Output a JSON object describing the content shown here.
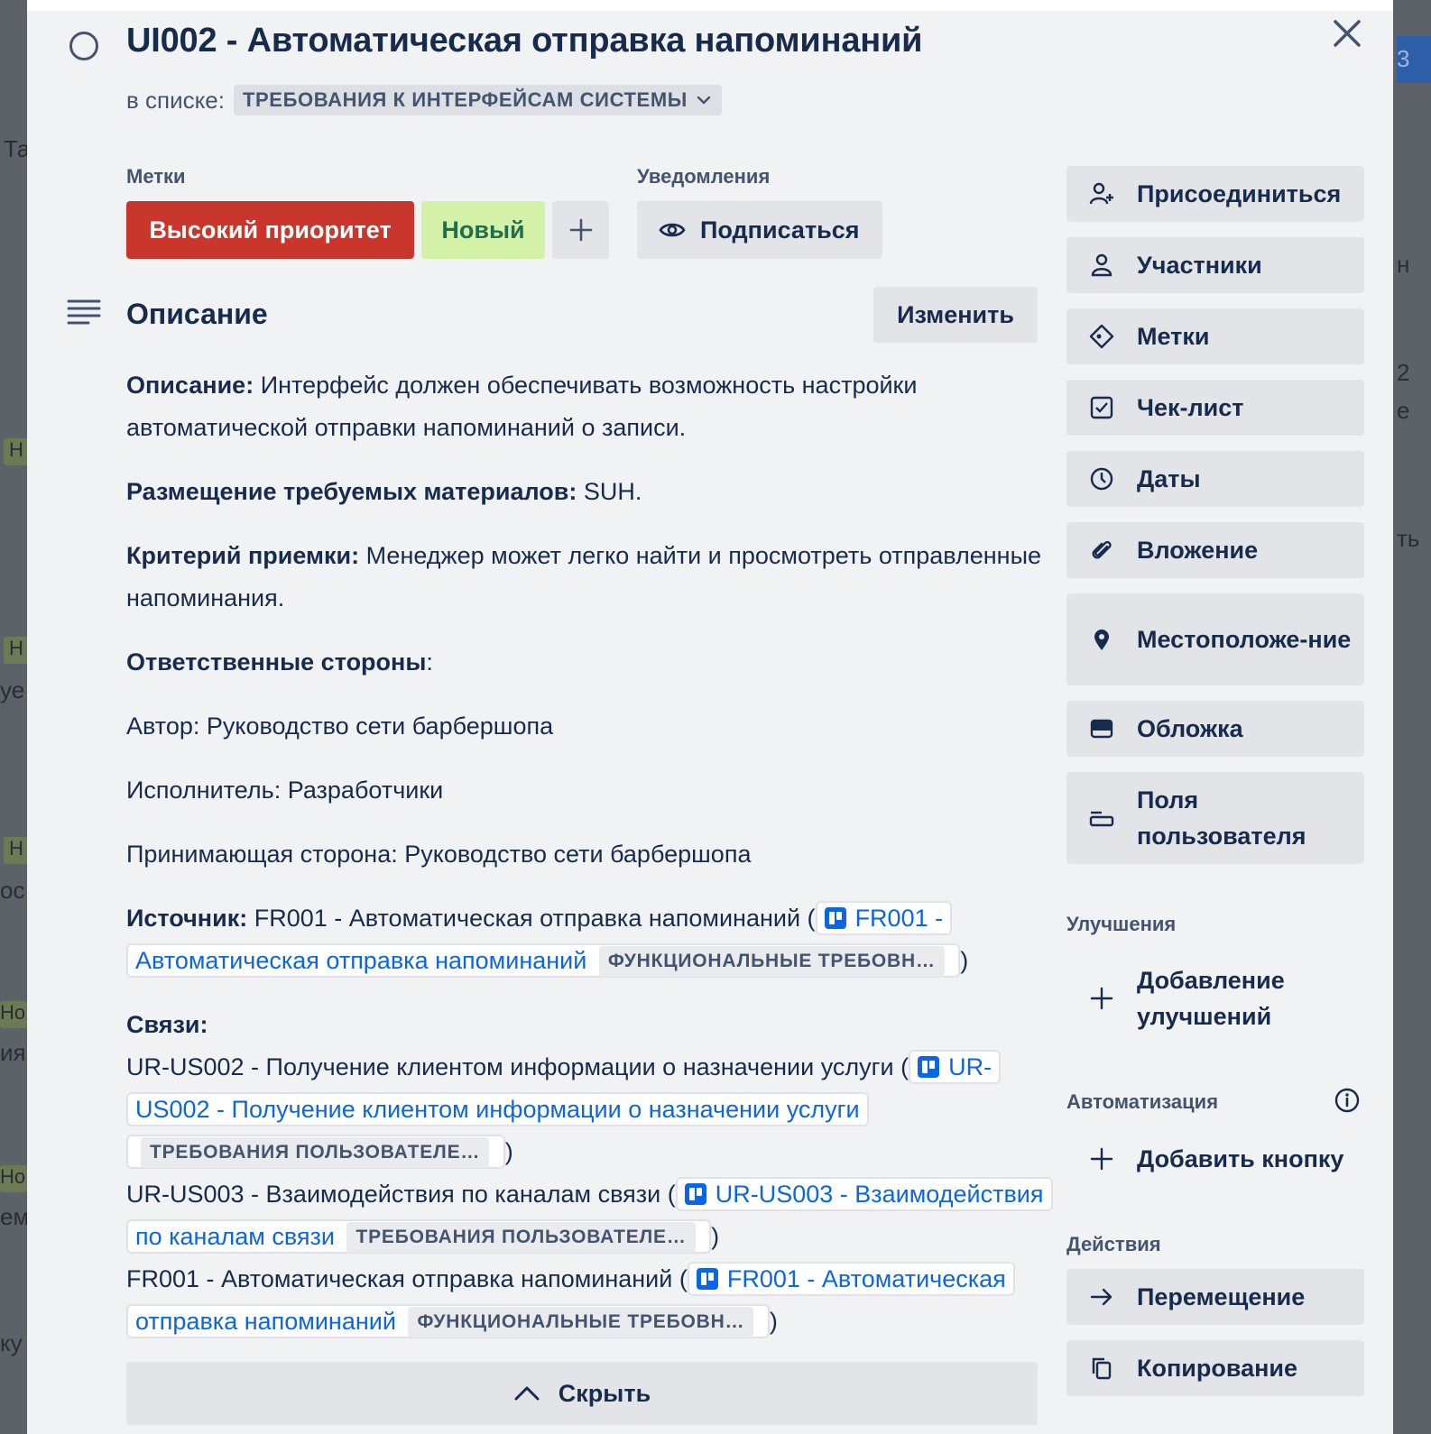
{
  "background": {
    "left_fragments": [
      "Та",
      "Н",
      "Н",
      "уе",
      "Н",
      "ос",
      "Но",
      "ия",
      "Но",
      "ем",
      "ку"
    ],
    "right_fragments": [
      "3",
      "н",
      "2",
      "е",
      "ть"
    ]
  },
  "card": {
    "title": "UI002 - Автоматическая отправка напоминаний",
    "in_list_label": "в списке:",
    "list_name": "ТРЕБОВАНИЯ К ИНТЕРФЕЙСАМ СИСТЕМЫ"
  },
  "labels": {
    "heading": "Метки",
    "items": [
      {
        "text": "Высокий приоритет",
        "color": "#c9372c"
      },
      {
        "text": "Новый",
        "color": "#d3f1a7"
      }
    ]
  },
  "notifications": {
    "heading": "Уведомления",
    "watch_label": "Подписаться"
  },
  "description": {
    "heading": "Описание",
    "edit_label": "Изменить",
    "p1_bold": "Описание:",
    "p1_text": " Интерфейс должен обеспечивать возможность настройки автоматической отправки напоминаний о записи.",
    "p2_bold": "Размещение требуемых материалов:",
    "p2_text": " SUH.",
    "p3_bold": "Критерий приемки:",
    "p3_text": " Менеджер может легко найти и просмотреть отправленные напоминания.",
    "p4_bold": "Ответственные стороны",
    "p4_text": ":",
    "author": "Автор: Руководство сети барбершопа",
    "executor": "Исполнитель: Разработчики",
    "acceptor": "Принимающая сторона: Руководство сети барбершопа",
    "source_bold": "Источник:",
    "source_text": " FR001 - Автоматическая отправка напоминаний (",
    "source_link": "FR001 - Автоматическая отправка напоминаний",
    "source_tag": "ФУНКЦИОНАЛЬНЫЕ ТРЕБОВН…",
    "close_paren": ")",
    "links_heading": "Связи:",
    "links": [
      {
        "text": "UR-US002 - Получение клиентом информации о назначении услуги (",
        "link": "UR-US002 - Получение клиентом информации о назначении услуги",
        "tag": "ТРЕБОВАНИЯ ПОЛЬЗОВАТЕЛЕ…"
      },
      {
        "text": "UR-US003 - Взаимодействия по каналам связи (",
        "link": "UR-US003 - Взаимодействия по каналам связи",
        "tag": "ТРЕБОВАНИЯ ПОЛЬЗОВАТЕЛЕ…"
      },
      {
        "text": "FR001 - Автоматическая отправка напоминаний (",
        "link": "FR001 - Автоматическая отправка напоминаний",
        "tag": "ФУНКЦИОНАЛЬНЫЕ ТРЕБОВН…"
      }
    ],
    "hide_label": "Скрыть"
  },
  "sidebar": {
    "add_to_card": [
      {
        "label": "Присоединиться",
        "icon": "join-icon"
      },
      {
        "label": "Участники",
        "icon": "member-icon"
      },
      {
        "label": "Метки",
        "icon": "label-icon"
      },
      {
        "label": "Чек-лист",
        "icon": "checklist-icon"
      },
      {
        "label": "Даты",
        "icon": "clock-icon"
      },
      {
        "label": "Вложение",
        "icon": "paperclip-icon"
      },
      {
        "label": "Местоположе-ние",
        "icon": "location-icon"
      },
      {
        "label": "Обложка",
        "icon": "cover-icon"
      },
      {
        "label": "Поля пользователя",
        "icon": "custom-fields-icon"
      }
    ],
    "powerups_heading": "Улучшения",
    "add_powerups_label": "Добавление улучшений",
    "automation_heading": "Автоматизация",
    "add_button_label": "Добавить кнопку",
    "actions_heading": "Действия",
    "actions": [
      {
        "label": "Перемещение",
        "icon": "arrow-right-icon"
      },
      {
        "label": "Копирование",
        "icon": "copy-icon"
      }
    ]
  }
}
